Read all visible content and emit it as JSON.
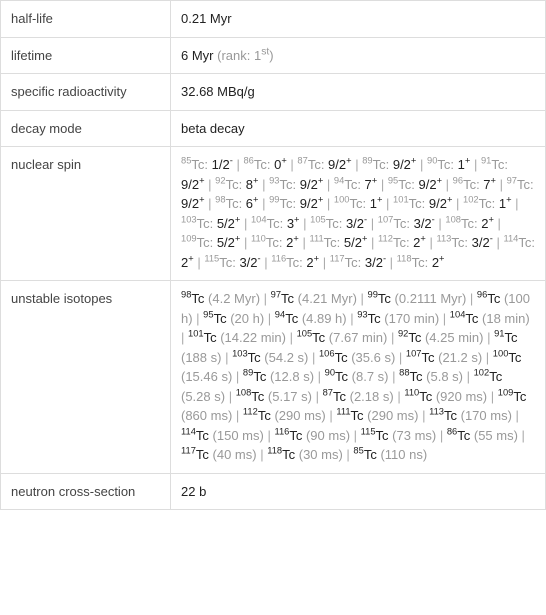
{
  "rows": {
    "half_life": {
      "label": "half-life",
      "value": "0.21 Myr"
    },
    "lifetime": {
      "label": "lifetime",
      "value": "6 Myr",
      "rank_prefix": "(rank: 1",
      "rank_suffix": ")",
      "rank_ord": "st"
    },
    "specific_radioactivity": {
      "label": "specific radioactivity",
      "value": "32.68 MBq/g"
    },
    "decay_mode": {
      "label": "decay mode",
      "value": "beta decay"
    },
    "nuclear_spin": {
      "label": "nuclear spin"
    },
    "unstable_isotopes": {
      "label": "unstable isotopes"
    },
    "neutron_cross_section": {
      "label": "neutron cross-section",
      "value": "22 b"
    }
  },
  "nuclear_spin_items": [
    {
      "mass": "85",
      "el": "Tc:",
      "spin": "1/2",
      "parity": "-"
    },
    {
      "mass": "86",
      "el": "Tc:",
      "spin": "0",
      "parity": "+"
    },
    {
      "mass": "87",
      "el": "Tc:",
      "spin": "9/2",
      "parity": "+"
    },
    {
      "mass": "89",
      "el": "Tc:",
      "spin": "9/2",
      "parity": "+"
    },
    {
      "mass": "90",
      "el": "Tc:",
      "spin": "1",
      "parity": "+"
    },
    {
      "mass": "91",
      "el": "Tc:",
      "spin": "9/2",
      "parity": "+"
    },
    {
      "mass": "92",
      "el": "Tc:",
      "spin": "8",
      "parity": "+"
    },
    {
      "mass": "93",
      "el": "Tc:",
      "spin": "9/2",
      "parity": "+"
    },
    {
      "mass": "94",
      "el": "Tc:",
      "spin": "7",
      "parity": "+"
    },
    {
      "mass": "95",
      "el": "Tc:",
      "spin": "9/2",
      "parity": "+"
    },
    {
      "mass": "96",
      "el": "Tc:",
      "spin": "7",
      "parity": "+"
    },
    {
      "mass": "97",
      "el": "Tc:",
      "spin": "9/2",
      "parity": "+"
    },
    {
      "mass": "98",
      "el": "Tc:",
      "spin": "6",
      "parity": "+"
    },
    {
      "mass": "99",
      "el": "Tc:",
      "spin": "9/2",
      "parity": "+"
    },
    {
      "mass": "100",
      "el": "Tc:",
      "spin": "1",
      "parity": "+"
    },
    {
      "mass": "101",
      "el": "Tc:",
      "spin": "9/2",
      "parity": "+"
    },
    {
      "mass": "102",
      "el": "Tc:",
      "spin": "1",
      "parity": "+"
    },
    {
      "mass": "103",
      "el": "Tc:",
      "spin": "5/2",
      "parity": "+"
    },
    {
      "mass": "104",
      "el": "Tc:",
      "spin": "3",
      "parity": "+"
    },
    {
      "mass": "105",
      "el": "Tc:",
      "spin": "3/2",
      "parity": "-"
    },
    {
      "mass": "107",
      "el": "Tc:",
      "spin": "3/2",
      "parity": "-"
    },
    {
      "mass": "108",
      "el": "Tc:",
      "spin": "2",
      "parity": "+"
    },
    {
      "mass": "109",
      "el": "Tc:",
      "spin": "5/2",
      "parity": "+"
    },
    {
      "mass": "110",
      "el": "Tc:",
      "spin": "2",
      "parity": "+"
    },
    {
      "mass": "111",
      "el": "Tc:",
      "spin": "5/2",
      "parity": "+"
    },
    {
      "mass": "112",
      "el": "Tc:",
      "spin": "2",
      "parity": "+"
    },
    {
      "mass": "113",
      "el": "Tc:",
      "spin": "3/2",
      "parity": "-"
    },
    {
      "mass": "114",
      "el": "Tc:",
      "spin": "2",
      "parity": "+"
    },
    {
      "mass": "115",
      "el": "Tc:",
      "spin": "3/2",
      "parity": "-"
    },
    {
      "mass": "116",
      "el": "Tc:",
      "spin": "2",
      "parity": "+"
    },
    {
      "mass": "117",
      "el": "Tc:",
      "spin": "3/2",
      "parity": "-"
    },
    {
      "mass": "118",
      "el": "Tc:",
      "spin": "2",
      "parity": "+"
    }
  ],
  "unstable_isotopes_items": [
    {
      "mass": "98",
      "el": "Tc",
      "hl": "(4.2 Myr)"
    },
    {
      "mass": "97",
      "el": "Tc",
      "hl": "(4.21 Myr)"
    },
    {
      "mass": "99",
      "el": "Tc",
      "hl": "(0.2111 Myr)"
    },
    {
      "mass": "96",
      "el": "Tc",
      "hl": "(100 h)"
    },
    {
      "mass": "95",
      "el": "Tc",
      "hl": "(20 h)"
    },
    {
      "mass": "94",
      "el": "Tc",
      "hl": "(4.89 h)"
    },
    {
      "mass": "93",
      "el": "Tc",
      "hl": "(170 min)"
    },
    {
      "mass": "104",
      "el": "Tc",
      "hl": "(18 min)"
    },
    {
      "mass": "101",
      "el": "Tc",
      "hl": "(14.22 min)"
    },
    {
      "mass": "105",
      "el": "Tc",
      "hl": "(7.67 min)"
    },
    {
      "mass": "92",
      "el": "Tc",
      "hl": "(4.25 min)"
    },
    {
      "mass": "91",
      "el": "Tc",
      "hl": "(188 s)"
    },
    {
      "mass": "103",
      "el": "Tc",
      "hl": "(54.2 s)"
    },
    {
      "mass": "106",
      "el": "Tc",
      "hl": "(35.6 s)"
    },
    {
      "mass": "107",
      "el": "Tc",
      "hl": "(21.2 s)"
    },
    {
      "mass": "100",
      "el": "Tc",
      "hl": "(15.46 s)"
    },
    {
      "mass": "89",
      "el": "Tc",
      "hl": "(12.8 s)"
    },
    {
      "mass": "90",
      "el": "Tc",
      "hl": "(8.7 s)"
    },
    {
      "mass": "88",
      "el": "Tc",
      "hl": "(5.8 s)"
    },
    {
      "mass": "102",
      "el": "Tc",
      "hl": "(5.28 s)"
    },
    {
      "mass": "108",
      "el": "Tc",
      "hl": "(5.17 s)"
    },
    {
      "mass": "87",
      "el": "Tc",
      "hl": "(2.18 s)"
    },
    {
      "mass": "110",
      "el": "Tc",
      "hl": "(920 ms)"
    },
    {
      "mass": "109",
      "el": "Tc",
      "hl": "(860 ms)"
    },
    {
      "mass": "112",
      "el": "Tc",
      "hl": "(290 ms)"
    },
    {
      "mass": "111",
      "el": "Tc",
      "hl": "(290 ms)"
    },
    {
      "mass": "113",
      "el": "Tc",
      "hl": "(170 ms)"
    },
    {
      "mass": "114",
      "el": "Tc",
      "hl": "(150 ms)"
    },
    {
      "mass": "116",
      "el": "Tc",
      "hl": "(90 ms)"
    },
    {
      "mass": "115",
      "el": "Tc",
      "hl": "(73 ms)"
    },
    {
      "mass": "86",
      "el": "Tc",
      "hl": "(55 ms)"
    },
    {
      "mass": "117",
      "el": "Tc",
      "hl": "(40 ms)"
    },
    {
      "mass": "118",
      "el": "Tc",
      "hl": "(30 ms)"
    },
    {
      "mass": "85",
      "el": "Tc",
      "hl": "(110 ns)"
    }
  ],
  "sep": " | "
}
